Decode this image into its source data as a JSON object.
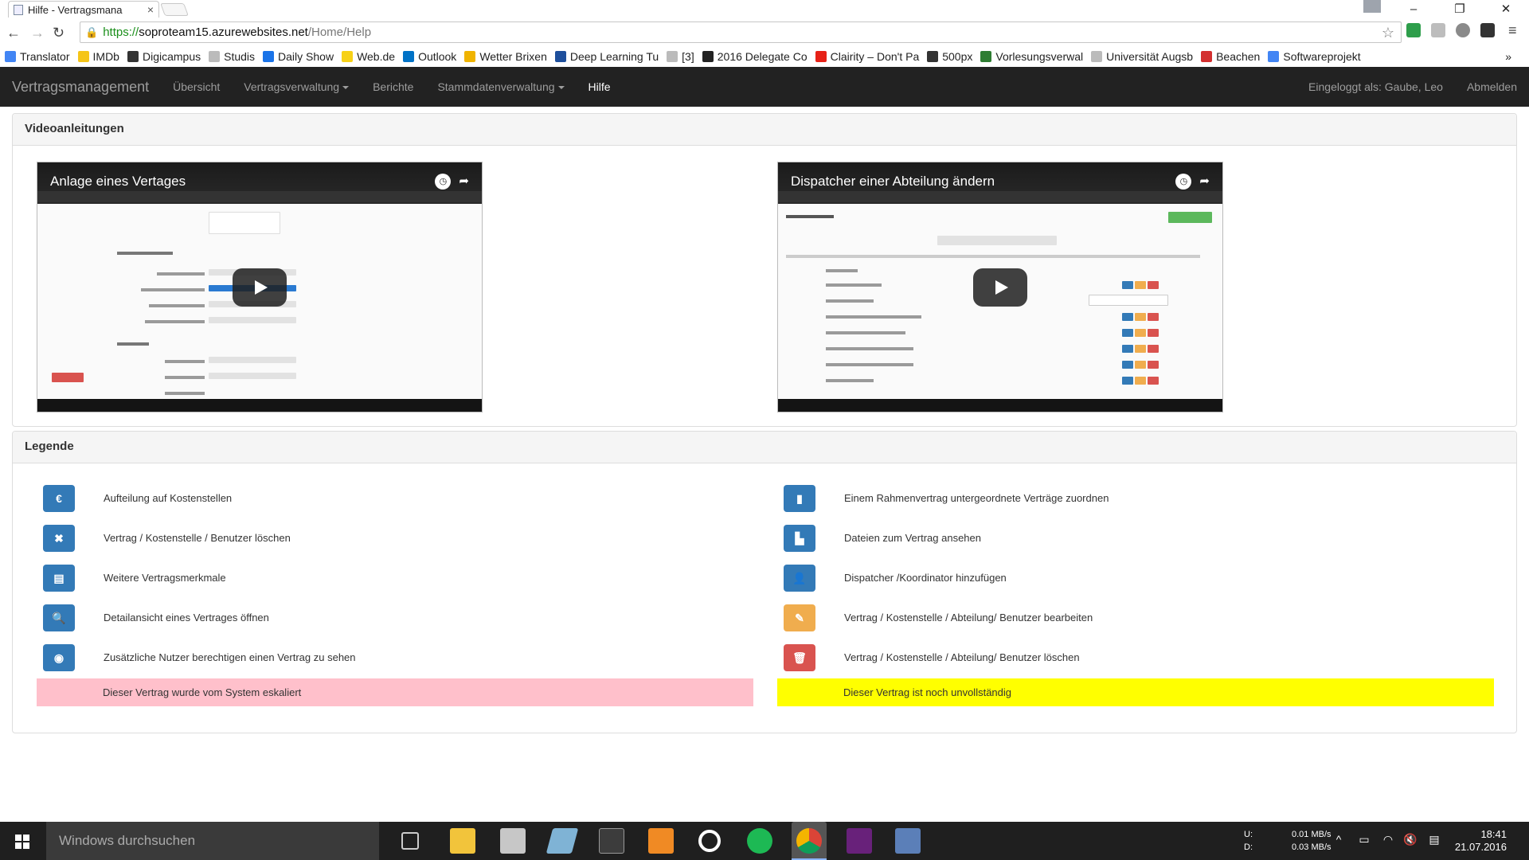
{
  "browser": {
    "tab_title": "Hilfe - Vertragsmana",
    "url_scheme": "https://",
    "url_host": "soproteam15.azurewebsites.net",
    "url_path": "/Home/Help",
    "bookmarks": [
      {
        "label": "Translator",
        "color": "#4285f4"
      },
      {
        "label": "IMDb",
        "color": "#f5c518"
      },
      {
        "label": "Digicampus",
        "color": "#333333"
      },
      {
        "label": "Studis",
        "color": "#bbbbbb"
      },
      {
        "label": "Daily Show",
        "color": "#1a73e8"
      },
      {
        "label": "Web.de",
        "color": "#f7d117"
      },
      {
        "label": "Outlook",
        "color": "#0072c6"
      },
      {
        "label": "Wetter Brixen",
        "color": "#f0b400"
      },
      {
        "label": "Deep Learning Tu",
        "color": "#1e4f9c"
      },
      {
        "label": "[3]",
        "color": "#bbbbbb"
      },
      {
        "label": "2016 Delegate Co",
        "color": "#222222"
      },
      {
        "label": "Clairity – Don't Pa",
        "color": "#e62117"
      },
      {
        "label": "500px",
        "color": "#333333"
      },
      {
        "label": "Vorlesungsverwal",
        "color": "#2e7d32"
      },
      {
        "label": "Universität Augsb",
        "color": "#bbbbbb"
      },
      {
        "label": "Beachen",
        "color": "#d32f2f"
      },
      {
        "label": "Softwareprojekt",
        "color": "#4285f4"
      }
    ]
  },
  "navbar": {
    "brand": "Vertragsmanagement",
    "items": [
      {
        "label": "Übersicht",
        "dropdown": false,
        "active": false
      },
      {
        "label": "Vertragsverwaltung",
        "dropdown": true,
        "active": false
      },
      {
        "label": "Berichte",
        "dropdown": false,
        "active": false
      },
      {
        "label": "Stammdatenverwaltung",
        "dropdown": true,
        "active": false
      },
      {
        "label": "Hilfe",
        "dropdown": false,
        "active": true
      }
    ],
    "user": "Eingeloggt als: Gaube, Leo",
    "logout": "Abmelden"
  },
  "videos": {
    "heading": "Videoanleitungen",
    "items": [
      {
        "title": "Anlage eines Vertages"
      },
      {
        "title": "Dispatcher einer Abteilung ändern"
      }
    ]
  },
  "legend": {
    "heading": "Legende",
    "left": [
      {
        "icon": "euro-icon",
        "glyph": "€",
        "color": "blue",
        "label": "Aufteilung auf Kostenstellen"
      },
      {
        "icon": "remove-icon",
        "glyph": "✖",
        "color": "blue",
        "label": "Vertrag / Kostenstelle / Benutzer löschen"
      },
      {
        "icon": "list-alt-icon",
        "glyph": "▤",
        "color": "blue",
        "label": "Weitere Vertragsmerkmale"
      },
      {
        "icon": "search-icon",
        "glyph": "🔍",
        "color": "blue",
        "label": "Detailansicht eines Vertrages öffnen"
      },
      {
        "icon": "eye-icon",
        "glyph": "◉",
        "color": "blue",
        "label": "Zusätzliche Nutzer berechtigen einen Vertrag zu sehen"
      }
    ],
    "right": [
      {
        "icon": "book-icon",
        "glyph": "▮",
        "color": "blue",
        "label": "Einem Rahmenvertrag untergeordnete Verträge zuordnen"
      },
      {
        "icon": "file-icon",
        "glyph": "▙",
        "color": "blue",
        "label": "Dateien zum Vertrag ansehen"
      },
      {
        "icon": "user-icon",
        "glyph": "👤",
        "color": "blue",
        "label": "Dispatcher /Koordinator hinzufügen"
      },
      {
        "icon": "pencil-icon",
        "glyph": "✎",
        "color": "orange",
        "label": "Vertrag / Kostenstelle / Abteilung/ Benutzer bearbeiten"
      },
      {
        "icon": "trash-icon",
        "glyph": "🗑",
        "color": "red",
        "label": "Vertrag / Kostenstelle / Abteilung/ Benutzer löschen"
      }
    ],
    "escalated": {
      "label": "Dieser Vertrag wurde vom System eskaliert",
      "color": "#ffc0cb"
    },
    "incomplete": {
      "label": "Dieser Vertrag ist noch unvollständig",
      "color": "#ffff00"
    }
  },
  "taskbar": {
    "search_placeholder": "Windows durchsuchen",
    "net_up_label": "U:",
    "net_down_label": "D:",
    "net_up": "0.01 MB/s",
    "net_down": "0.03 MB/s",
    "time": "18:41",
    "date": "21.07.2016"
  }
}
